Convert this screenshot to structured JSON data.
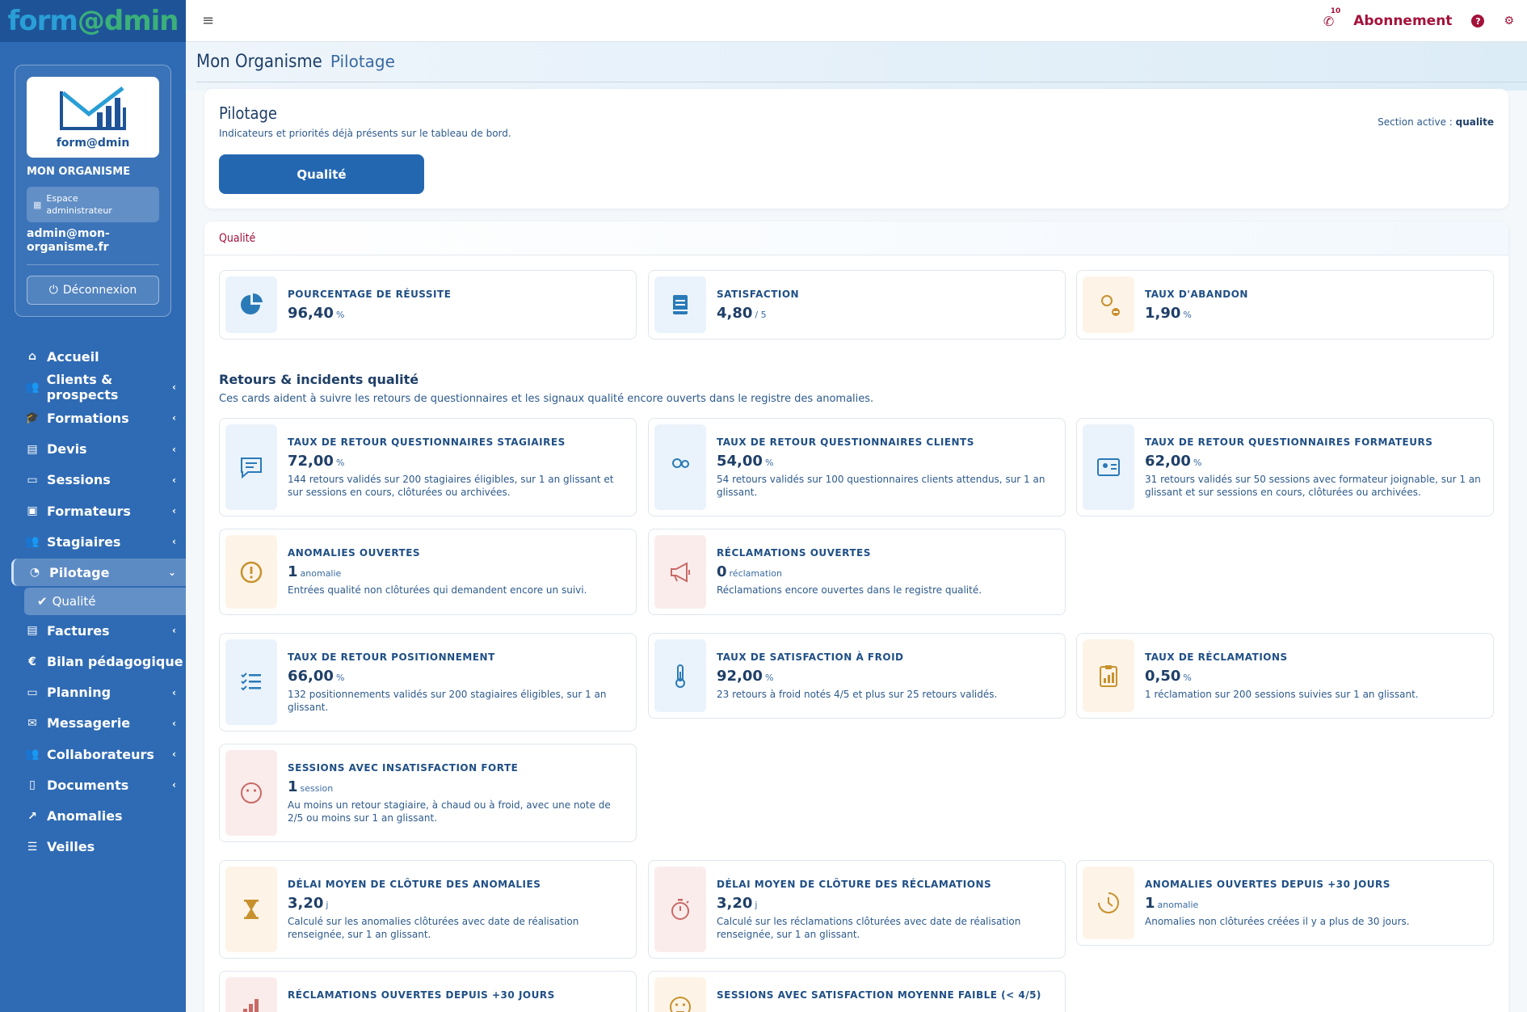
{
  "brand": {
    "text_a": "form",
    "text_b": "@dmin"
  },
  "topbar": {
    "notif_count": "10",
    "abonnement": "Abonnement",
    "help": "?"
  },
  "sidebar": {
    "logo_caption": "form@dmin",
    "org_name": "MON ORGANISME",
    "space_label_1": "Espace",
    "space_label_2": "administrateur",
    "email": "admin@mon-organisme.fr",
    "logout": "Déconnexion",
    "items": [
      {
        "label": "Accueil",
        "icon": "home-icon",
        "chev": false
      },
      {
        "label": "Clients & prospects",
        "icon": "users-icon",
        "chev": true
      },
      {
        "label": "Formations",
        "icon": "graduation-icon",
        "chev": true
      },
      {
        "label": "Devis",
        "icon": "document-icon",
        "chev": true
      },
      {
        "label": "Sessions",
        "icon": "calendar-icon",
        "chev": true
      },
      {
        "label": "Formateurs",
        "icon": "trainer-icon",
        "chev": true
      },
      {
        "label": "Stagiaires",
        "icon": "users-icon",
        "chev": true
      },
      {
        "label": "Pilotage",
        "icon": "gauge-icon",
        "chev": true,
        "active": true
      },
      {
        "label": "Factures",
        "icon": "invoice-icon",
        "chev": true
      },
      {
        "label": "Bilan pédagogique",
        "icon": "euro-icon",
        "chev": false
      },
      {
        "label": "Planning",
        "icon": "calendar-icon",
        "chev": true
      },
      {
        "label": "Messagerie",
        "icon": "mail-icon",
        "chev": true
      },
      {
        "label": "Collaborateurs",
        "icon": "users-icon",
        "chev": true
      },
      {
        "label": "Documents",
        "icon": "file-icon",
        "chev": true
      },
      {
        "label": "Anomalies",
        "icon": "chart-line-icon",
        "chev": false
      },
      {
        "label": "Veilles",
        "icon": "sliders-icon",
        "chev": false
      }
    ],
    "sub_active": "Qualité"
  },
  "page": {
    "title": "Mon Organisme",
    "subtitle": "Pilotage"
  },
  "main_card": {
    "title": "Pilotage",
    "subtitle": "Indicateurs et priorités déjà présents sur le tableau de bord.",
    "button": "Qualité",
    "active_label": "Section active :",
    "active_value": "qualite"
  },
  "section": {
    "title": "Qualité",
    "subsection_title": "Retours & incidents qualité",
    "subsection_desc": "Ces cards aident à suivre les retours de questionnaires et les signaux qualité encore ouverts dans le registre des anomalies."
  },
  "kpis": [
    {
      "label": "Pourcentage de réussite",
      "value": "96,40",
      "unit": "%",
      "desc": "",
      "icon": "pie-chart-icon",
      "tone": "blue"
    },
    {
      "label": "Satisfaction",
      "value": "4,80",
      "unit": "/ 5",
      "desc": "",
      "icon": "book-icon",
      "tone": "blue"
    },
    {
      "label": "Taux d'abandon",
      "value": "1,90",
      "unit": "%",
      "desc": "",
      "icon": "user-minus-icon",
      "tone": "peach"
    },
    {
      "label": "Taux de retour questionnaires stagiaires",
      "value": "72,00",
      "unit": "%",
      "desc": "144 retours validés sur 200 stagiaires éligibles, sur 1 an glissant et sur sessions en cours, clôturées ou archivées.",
      "icon": "message-icon",
      "tone": "blue"
    },
    {
      "label": "Taux de retour questionnaires clients",
      "value": "54,00",
      "unit": "%",
      "desc": "54 retours validés sur 100 questionnaires clients attendus, sur 1 an glissant.",
      "icon": "users-icon",
      "tone": "blue"
    },
    {
      "label": "Taux de retour questionnaires formateurs",
      "value": "62,00",
      "unit": "%",
      "desc": "31 retours validés sur 50 sessions avec formateur joignable, sur 1 an glissant et sur sessions en cours, clôturées ou archivées.",
      "icon": "id-card-icon",
      "tone": "blue"
    },
    {
      "label": "Anomalies ouvertes",
      "value": "1",
      "unit": "anomalie",
      "desc": "Entrées qualité non clôturées qui demandent encore un suivi.",
      "icon": "alert-icon",
      "tone": "peach"
    },
    {
      "label": "Réclamations ouvertes",
      "value": "0",
      "unit": "réclamation",
      "desc": "Réclamations encore ouvertes dans le registre qualité.",
      "icon": "megaphone-icon",
      "tone": "pink"
    },
    {
      "label": "Taux de retour positionnement",
      "value": "66,00",
      "unit": "%",
      "desc": "132 positionnements validés sur 200 stagiaires éligibles, sur 1 an glissant.",
      "icon": "checklist-icon",
      "tone": "blue"
    },
    {
      "label": "Taux de satisfaction à froid",
      "value": "92,00",
      "unit": "%",
      "desc": "23 retours à froid notés 4/5 et plus sur 25 retours validés.",
      "icon": "thermometer-icon",
      "tone": "blue"
    },
    {
      "label": "Taux de réclamations",
      "value": "0,50",
      "unit": "%",
      "desc": "1 réclamation sur 200 sessions suivies sur 1 an glissant.",
      "icon": "clipboard-chart-icon",
      "tone": "peach"
    },
    {
      "label": "Sessions avec insatisfaction forte",
      "value": "1",
      "unit": "session",
      "desc": "Au moins un retour stagiaire, à chaud ou à froid, avec une note de 2/5 ou moins sur 1 an glissant.",
      "icon": "sad-face-icon",
      "tone": "pink"
    },
    {
      "label": "Délai moyen de clôture des anomalies",
      "value": "3,20",
      "unit": "j",
      "desc": "Calculé sur les anomalies clôturées avec date de réalisation renseignée, sur 1 an glissant.",
      "icon": "hourglass-icon",
      "tone": "peach"
    },
    {
      "label": "Délai moyen de clôture des réclamations",
      "value": "3,20",
      "unit": "j",
      "desc": "Calculé sur les réclamations clôturées avec date de réalisation renseignée, sur 1 an glissant.",
      "icon": "stopwatch-icon",
      "tone": "pink"
    },
    {
      "label": "Anomalies ouvertes depuis +30 jours",
      "value": "1",
      "unit": "anomalie",
      "desc": "Anomalies non clôturées créées il y a plus de 30 jours.",
      "icon": "clock-icon",
      "tone": "peach"
    },
    {
      "label": "Réclamations ouvertes depuis +30 jours",
      "value": "",
      "unit": "",
      "desc": "",
      "icon": "bar-chart-icon",
      "tone": "pink"
    },
    {
      "label": "Sessions avec satisfaction moyenne faible (< 4/5)",
      "value": "",
      "unit": "",
      "desc": "",
      "icon": "face-icon",
      "tone": "peach"
    }
  ],
  "colors": {
    "primary": "#2467b1",
    "sidebar": "#2f6bb4",
    "accent": "#a3123a",
    "icon_blue": "#2a7ab8",
    "icon_peach": "#c8912e",
    "icon_pink": "#c86a66"
  }
}
